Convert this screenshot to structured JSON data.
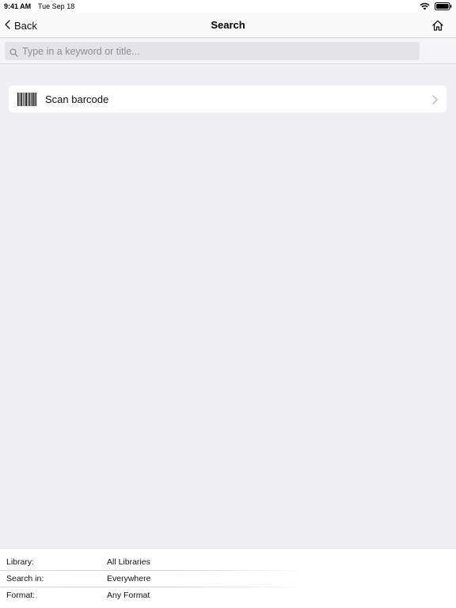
{
  "status_bar": {
    "time": "9:41 AM",
    "date": "Tue Sep 18",
    "icons": [
      "wifi-icon",
      "battery-icon"
    ]
  },
  "nav": {
    "back_label": "Back",
    "title": "Search",
    "home_icon": "home-icon"
  },
  "search": {
    "placeholder": "Type in a keyword or title...",
    "value": ""
  },
  "scan": {
    "label": "Scan barcode",
    "icon": "barcode-icon"
  },
  "filters": [
    {
      "label": "Library:",
      "value": "All Libraries"
    },
    {
      "label": "Search in:",
      "value": "Everywhere"
    },
    {
      "label": "Format:",
      "value": "Any Format"
    }
  ],
  "colors": {
    "background": "#efeff4",
    "nav_background": "#f9f9f9",
    "search_field": "#e4e4e8",
    "placeholder": "#8e8e93"
  }
}
